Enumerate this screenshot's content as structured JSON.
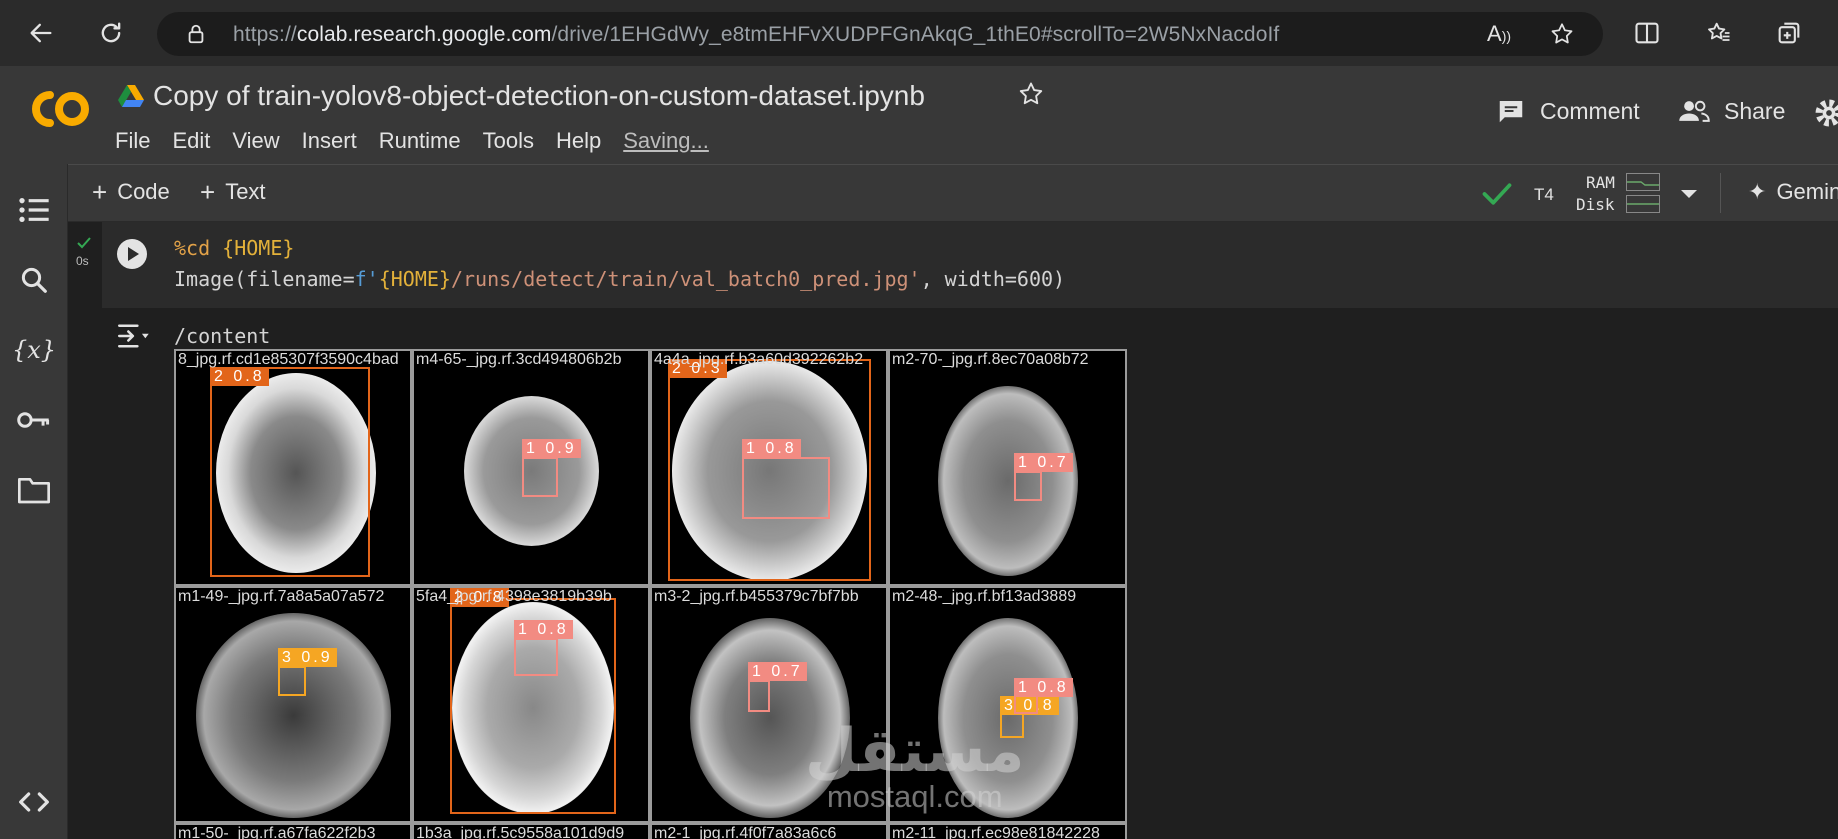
{
  "browser": {
    "url_prefix": "https://",
    "url_host": "colab.research.google.com",
    "url_path": "/drive/1EHGdWy_e8tmEHFvXUDPFGnAkqG_1thE0#scrollTo=2W5NxNacdoIf",
    "read_aloud_label": "A"
  },
  "colab": {
    "logo_text": "CO",
    "title": "Copy of train-yolov8-object-detection-on-custom-dataset.ipynb",
    "menu": [
      "File",
      "Edit",
      "View",
      "Insert",
      "Runtime",
      "Tools",
      "Help"
    ],
    "saving_label": "Saving...",
    "comment_label": "Comment",
    "share_label": "Share"
  },
  "toolbar": {
    "code_label": "Code",
    "text_label": "Text",
    "runtime_label": "T4",
    "ram_label": "RAM",
    "disk_label": "Disk",
    "gemini_label": "Gemin"
  },
  "cell": {
    "exec_time": "0s",
    "line1_magic": "%cd",
    "line1_var": "{HOME}",
    "line2_fn": "Image(filename=",
    "line2_prefix": "f'",
    "line2_var": "{HOME}",
    "line2_str": "/runs/detect/train/val_batch0_pred.jpg'",
    "line2_rest": ", width=600)"
  },
  "output": {
    "stdout": "/content",
    "tiles": [
      {
        "label": "8_jpg.rf.cd1e85307f3590c4bad",
        "tag": "2 0.8",
        "tag_color": "#e2651a"
      },
      {
        "label": "m4-65-_jpg.rf.3cd494806b2b",
        "tag": "1 0.9",
        "tag_color": "#f28b82"
      },
      {
        "label": "4a4a_jpg.rf.b3a60d392262b2",
        "tag": "2 0.3",
        "tag_color": "#e2651a"
      },
      {
        "label": "m2-70-_jpg.rf.8ec70a08b72",
        "tag": "1 0.7",
        "tag_color": "#f28b82"
      },
      {
        "label": "m1-49-_jpg.rf.7a8a5a07a572",
        "tag": "3 0.9",
        "tag_color": "#f5a623"
      },
      {
        "label": "5fa4_jpg.rf.4398e3819b39b",
        "tag": "2 0.8",
        "tag_color": "#e2651a",
        "tag2": "1 0.8",
        "tag2_color": "#f28b82"
      },
      {
        "label": "m3-2_jpg.rf.b455379c7bf7bb",
        "tag": "1 0.7",
        "tag_color": "#f28b82"
      },
      {
        "label": "m2-48-_jpg.rf.bf13ad3889",
        "tag": "3 0.8",
        "tag_color": "#f5a623",
        "tag2": "1 0.8",
        "tag2_color": "#f28b82"
      },
      {
        "label": "m1-50-_jpg.rf.a67fa622f2b3",
        "tag": "",
        "tag_color": "#f28b82"
      },
      {
        "label": "1b3a_jpg.rf.5c9558a101d9d9",
        "tag": "",
        "tag_color": "#f28b82"
      },
      {
        "label": "m2-1_jpg.rf.4f0f7a83a6c6",
        "tag": "",
        "tag_color": "#f28b82"
      },
      {
        "label": "m2-11_jpg.rf.ec98e81842228",
        "tag": "",
        "tag_color": "#f28b82"
      }
    ]
  },
  "watermark": {
    "arabic": "مستقل",
    "latin": "mostaql.com"
  }
}
